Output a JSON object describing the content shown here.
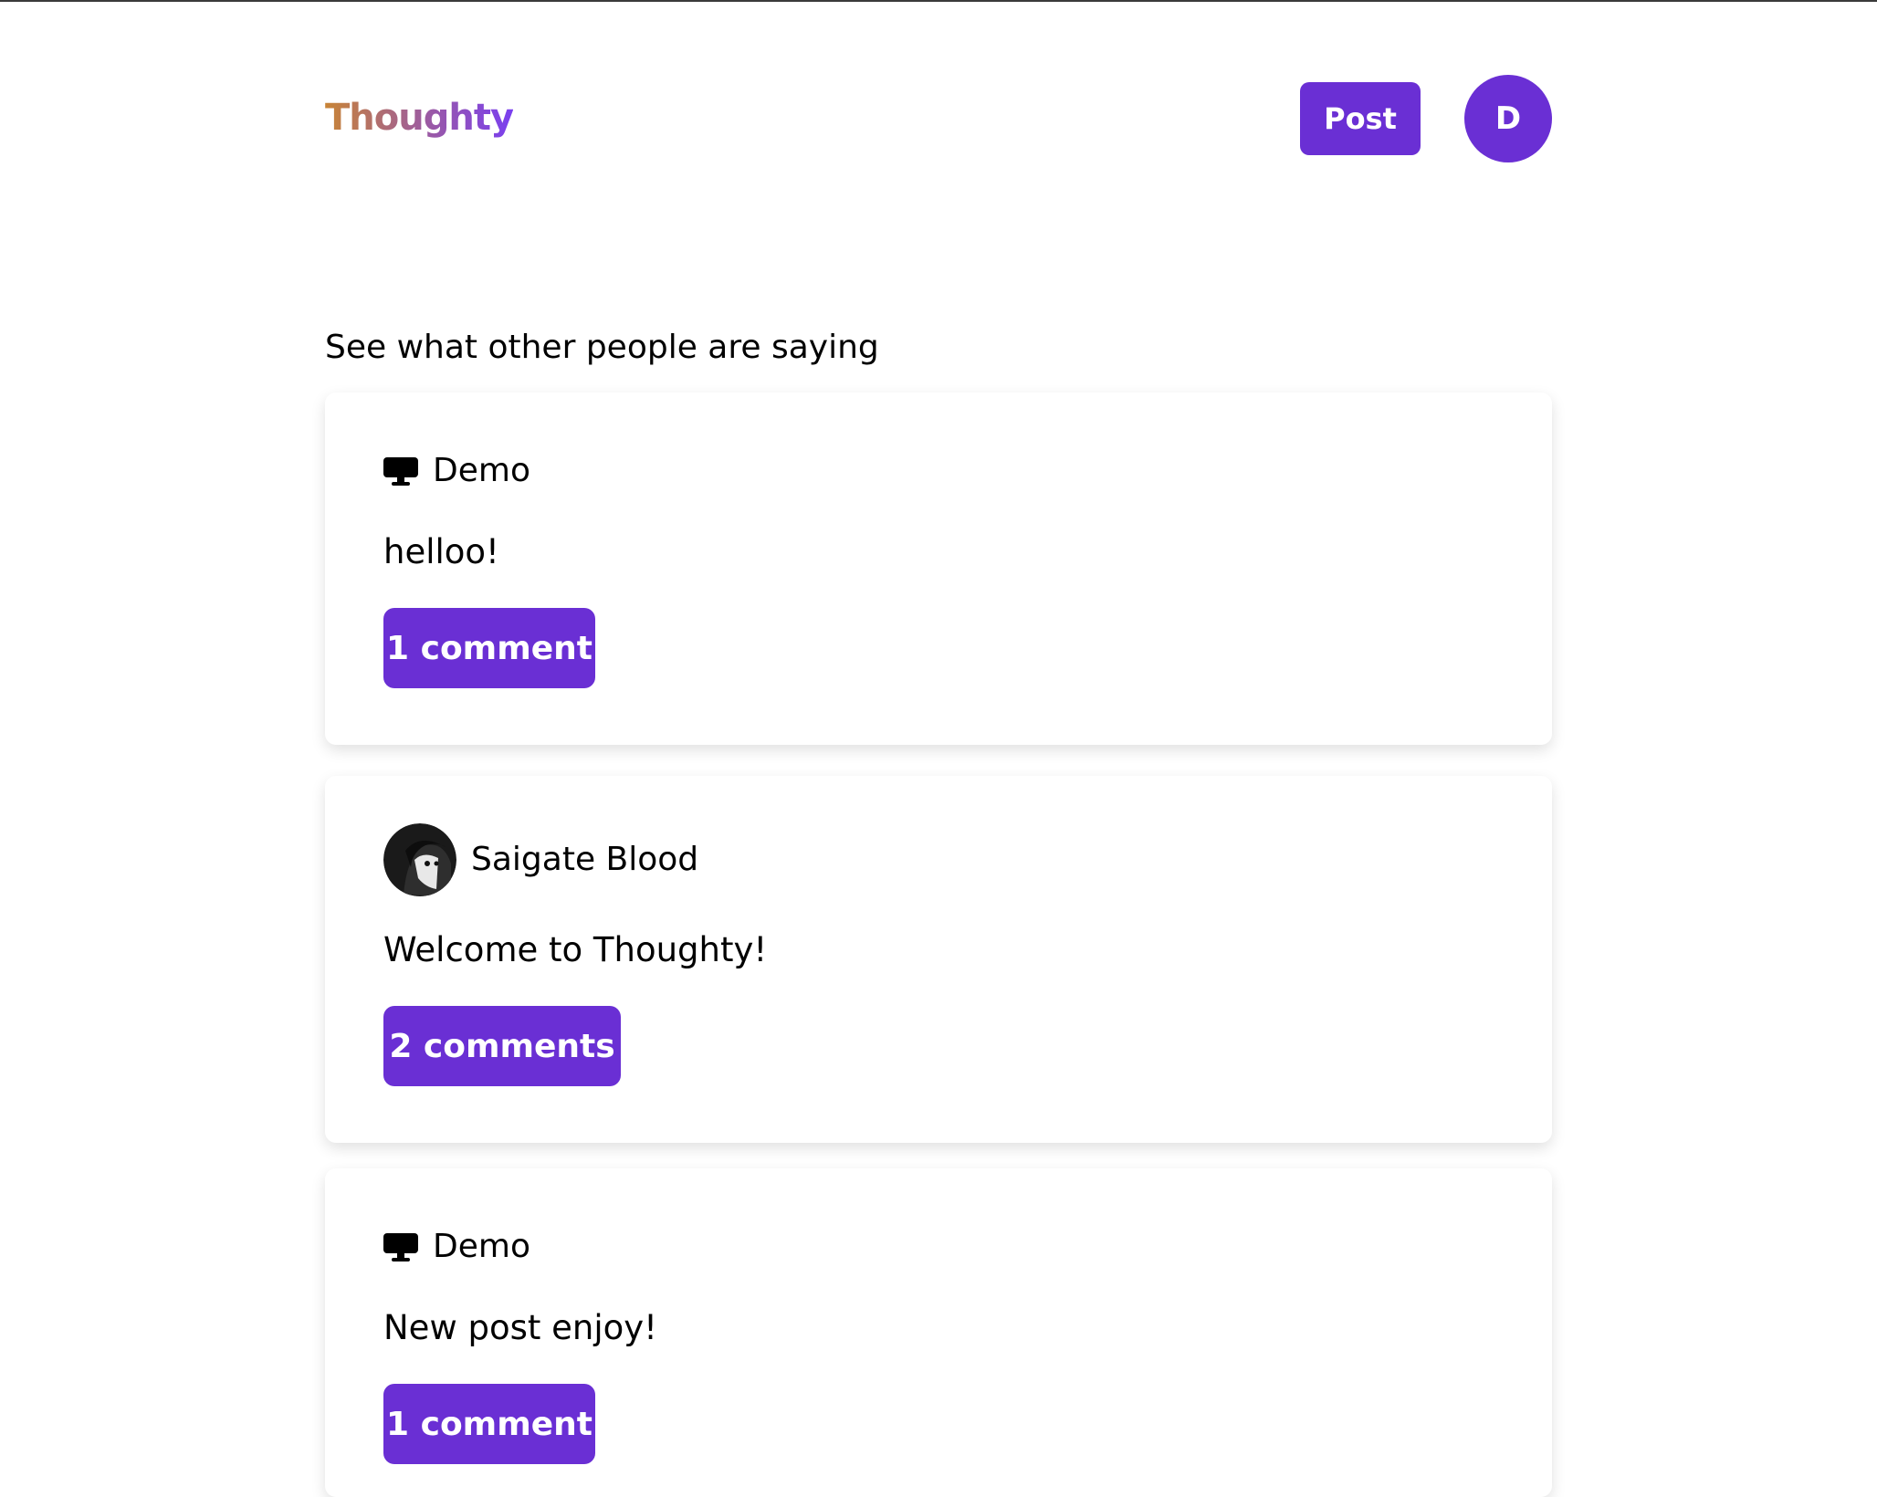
{
  "header": {
    "logo": "Thoughty",
    "post_button": "Post",
    "user_initial": "D"
  },
  "main": {
    "heading": "See what other people are saying",
    "posts": [
      {
        "author": "Demo",
        "author_icon": "monitor-icon",
        "text": "helloo!",
        "comments_label": "1 comment"
      },
      {
        "author": "Saigate Blood",
        "author_icon": "user-avatar",
        "text": "Welcome to Thoughty!",
        "comments_label": "2 comments"
      },
      {
        "author": "Demo",
        "author_icon": "monitor-icon",
        "text": "New post enjoy!",
        "comments_label": "1 comment"
      }
    ]
  },
  "colors": {
    "accent": "#6a2fd4",
    "logo_gradient_start": "#c88436",
    "logo_gradient_end": "#7a3ff0"
  }
}
